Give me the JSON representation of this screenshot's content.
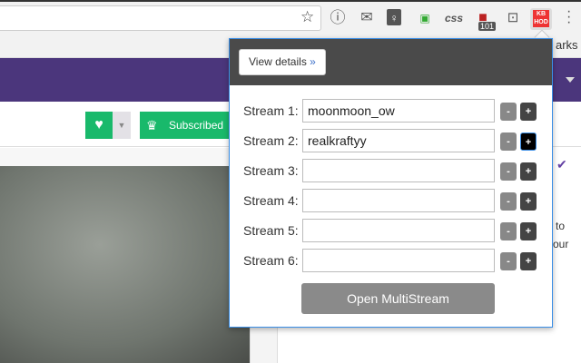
{
  "browser": {
    "bookmarks_partial": "arks",
    "badge_count": "101",
    "css_ext": "css",
    "kb_ext": "KB HOD"
  },
  "channel": {
    "subscribed_label": "Subscribed"
  },
  "side_text": {
    "line1": "to",
    "line2": "our"
  },
  "popup": {
    "view_details_label": "View details",
    "view_details_chevron": "»",
    "streams": [
      {
        "label": "Stream 1:",
        "value": "moonmoon_ow"
      },
      {
        "label": "Stream 2:",
        "value": "realkraftyy"
      },
      {
        "label": "Stream 3:",
        "value": ""
      },
      {
        "label": "Stream 4:",
        "value": ""
      },
      {
        "label": "Stream 5:",
        "value": ""
      },
      {
        "label": "Stream 6:",
        "value": ""
      }
    ],
    "minus_label": "-",
    "plus_label": "+",
    "open_label": "Open MultiStream"
  },
  "colors": {
    "accent": "#19b96b",
    "purple": "#4b367c",
    "popup_header": "#4a4a4a"
  }
}
